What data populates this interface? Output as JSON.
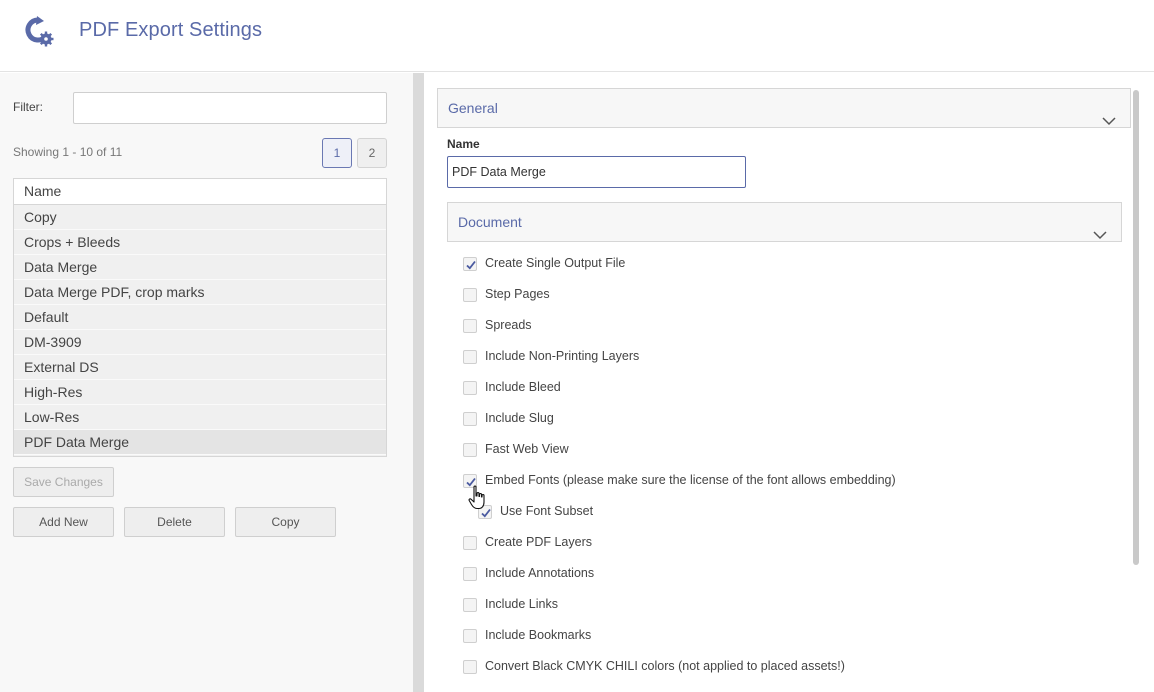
{
  "header": {
    "title": "PDF Export Settings",
    "logo_icon": "gear-refresh-icon"
  },
  "filter": {
    "label": "Filter:",
    "value": "",
    "placeholder": ""
  },
  "pagination": {
    "showing": "Showing 1 - 10 of 11",
    "pages": [
      "1",
      "2"
    ],
    "current_page": "1"
  },
  "list": {
    "header": "Name",
    "items": [
      "Copy",
      "Crops + Bleeds",
      "Data Merge",
      "Data Merge PDF, crop marks",
      "Default",
      "DM-3909",
      "External DS",
      "High-Res",
      "Low-Res",
      "PDF Data Merge"
    ],
    "selected": "PDF Data Merge"
  },
  "buttons": {
    "save": "Save Changes",
    "add_new": "Add New",
    "delete": "Delete",
    "copy": "Copy"
  },
  "general": {
    "title": "General",
    "name_label": "Name",
    "name_value": "PDF Data Merge"
  },
  "document": {
    "title": "Document",
    "options": [
      {
        "label": "Create Single Output File",
        "checked": true
      },
      {
        "label": "Step Pages",
        "checked": false
      },
      {
        "label": "Spreads",
        "checked": false
      },
      {
        "label": "Include Non-Printing Layers",
        "checked": false
      },
      {
        "label": "Include Bleed",
        "checked": false
      },
      {
        "label": "Include Slug",
        "checked": false
      },
      {
        "label": "Fast Web View",
        "checked": false
      },
      {
        "label": "Embed Fonts (please make sure the license of the font allows embedding)",
        "checked": true
      },
      {
        "label": "Use Font Subset",
        "checked": true
      },
      {
        "label": "Create PDF Layers",
        "checked": false
      },
      {
        "label": "Include Annotations",
        "checked": false
      },
      {
        "label": "Include Links",
        "checked": false
      },
      {
        "label": "Include Bookmarks",
        "checked": false
      },
      {
        "label": "Convert Black CMYK CHILI colors (not applied to placed assets!)",
        "checked": false
      }
    ]
  },
  "colors": {
    "accent": "#5a6aa8",
    "check": "#4a5aa0"
  }
}
